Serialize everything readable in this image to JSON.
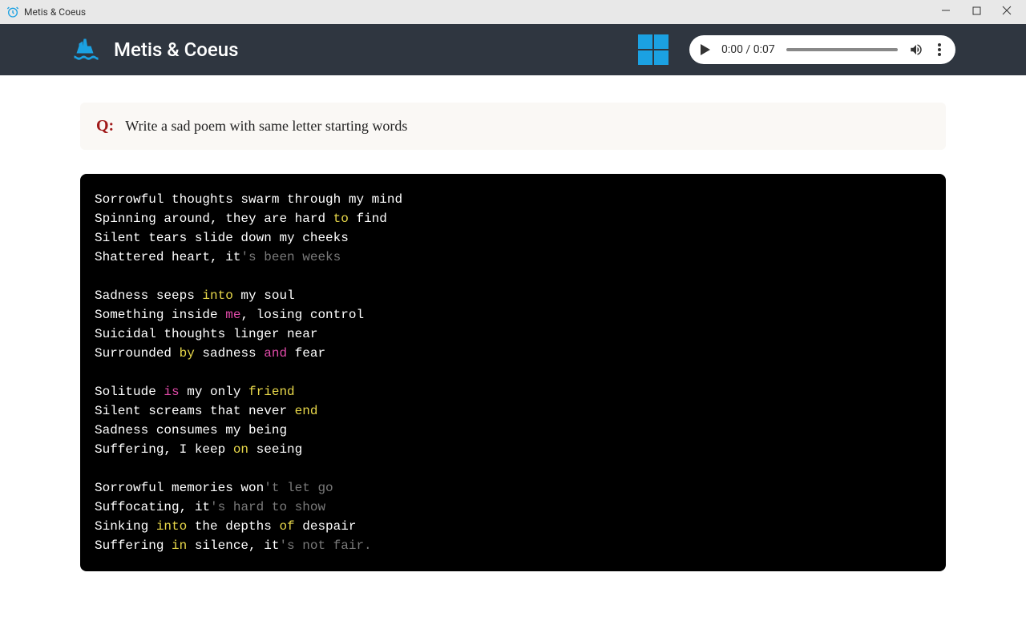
{
  "titlebar": {
    "title": "Metis & Coeus"
  },
  "header": {
    "title": "Metis & Coeus"
  },
  "audio": {
    "time": "0:00 / 0:07"
  },
  "question": {
    "label": "Q:",
    "text": "Write a sad poem with same letter starting words"
  },
  "poem": {
    "lines": [
      [
        {
          "t": "Sorrowful thoughts swarm through my mind",
          "c": ""
        }
      ],
      [
        {
          "t": "Spinning around, they are hard ",
          "c": ""
        },
        {
          "t": "to",
          "c": "kw"
        },
        {
          "t": " find",
          "c": ""
        }
      ],
      [
        {
          "t": "Silent tears slide down my cheeks",
          "c": ""
        }
      ],
      [
        {
          "t": "Shattered heart, it",
          "c": ""
        },
        {
          "t": "'s been weeks",
          "c": "cm"
        }
      ],
      [],
      [
        {
          "t": "Sadness seeps ",
          "c": ""
        },
        {
          "t": "into",
          "c": "kw"
        },
        {
          "t": " my soul",
          "c": ""
        }
      ],
      [
        {
          "t": "Something inside ",
          "c": ""
        },
        {
          "t": "me",
          "c": "kw2"
        },
        {
          "t": ", losing control",
          "c": ""
        }
      ],
      [
        {
          "t": "Suicidal thoughts linger near",
          "c": ""
        }
      ],
      [
        {
          "t": "Surrounded ",
          "c": ""
        },
        {
          "t": "by",
          "c": "kw"
        },
        {
          "t": " sadness ",
          "c": ""
        },
        {
          "t": "and",
          "c": "kw2"
        },
        {
          "t": " fear",
          "c": ""
        }
      ],
      [],
      [
        {
          "t": "Solitude ",
          "c": ""
        },
        {
          "t": "is",
          "c": "kw2"
        },
        {
          "t": " my only ",
          "c": ""
        },
        {
          "t": "friend",
          "c": "kw"
        }
      ],
      [
        {
          "t": "Silent screams that never ",
          "c": ""
        },
        {
          "t": "end",
          "c": "kw"
        }
      ],
      [
        {
          "t": "Sadness consumes my being",
          "c": ""
        }
      ],
      [
        {
          "t": "Suffering, I keep ",
          "c": ""
        },
        {
          "t": "on",
          "c": "kw"
        },
        {
          "t": " seeing",
          "c": ""
        }
      ],
      [],
      [
        {
          "t": "Sorrowful memories won",
          "c": ""
        },
        {
          "t": "'t let go",
          "c": "cm"
        }
      ],
      [
        {
          "t": "Suffocating, it",
          "c": ""
        },
        {
          "t": "'s hard to show",
          "c": "cm"
        }
      ],
      [
        {
          "t": "Sinking ",
          "c": ""
        },
        {
          "t": "into",
          "c": "kw"
        },
        {
          "t": " the depths ",
          "c": ""
        },
        {
          "t": "of",
          "c": "kw"
        },
        {
          "t": " despair",
          "c": ""
        }
      ],
      [
        {
          "t": "Suffering ",
          "c": ""
        },
        {
          "t": "in",
          "c": "kw"
        },
        {
          "t": " silence, it",
          "c": ""
        },
        {
          "t": "'s not fair.",
          "c": "cm"
        }
      ]
    ]
  }
}
